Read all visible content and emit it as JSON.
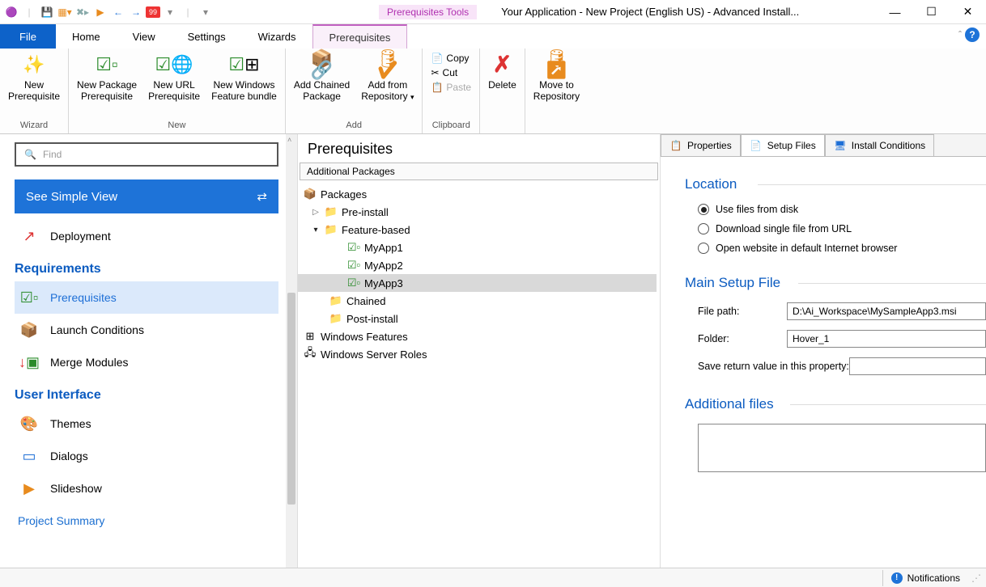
{
  "titlebar": {
    "tools_tab": "Prerequisites Tools",
    "title": "Your Application - New Project (English US) - Advanced Install...",
    "qat_badge": "99"
  },
  "tabs": {
    "file": "File",
    "home": "Home",
    "view": "View",
    "settings": "Settings",
    "wizards": "Wizards",
    "prerequisites": "Prerequisites"
  },
  "ribbon": {
    "wizard": {
      "new_prereq": "New\nPrerequisite",
      "group": "Wizard"
    },
    "new": {
      "new_package": "New Package\nPrerequisite",
      "new_url": "New URL\nPrerequisite",
      "new_bundle": "New Windows\nFeature bundle",
      "group": "New"
    },
    "add": {
      "add_chained": "Add Chained\nPackage",
      "add_repo": "Add from\nRepository",
      "group": "Add"
    },
    "clipboard": {
      "copy": "Copy",
      "cut": "Cut",
      "paste": "Paste",
      "group": "Clipboard"
    },
    "delete": "Delete",
    "move": "Move to\nRepository"
  },
  "sidebar": {
    "search_placeholder": "Find",
    "simple_view": "See Simple View",
    "deployment": "Deployment",
    "sections": {
      "requirements": "Requirements",
      "ui": "User Interface"
    },
    "items": {
      "prerequisites": "Prerequisites",
      "launch_conditions": "Launch Conditions",
      "merge_modules": "Merge Modules",
      "themes": "Themes",
      "dialogs": "Dialogs",
      "slideshow": "Slideshow"
    },
    "project_summary": "Project Summary"
  },
  "center": {
    "header": "Prerequisites",
    "additional_packages": "Additional Packages",
    "tree": {
      "packages": "Packages",
      "pre_install": "Pre-install",
      "feature_based": "Feature-based",
      "myapp1": "MyApp1",
      "myapp2": "MyApp2",
      "myapp3": "MyApp3",
      "chained": "Chained",
      "post_install": "Post-install",
      "windows_features": "Windows Features",
      "windows_server_roles": "Windows Server Roles"
    }
  },
  "right": {
    "tabs": {
      "properties": "Properties",
      "setup_files": "Setup Files",
      "install_conditions": "Install Conditions"
    },
    "location": {
      "title": "Location",
      "use_files": "Use files from disk",
      "download": "Download single file from URL",
      "open_website": "Open website in default Internet browser"
    },
    "main_setup": {
      "title": "Main Setup File",
      "file_path_label": "File path:",
      "file_path_value": "D:\\Ai_Workspace\\MySampleApp3.msi",
      "folder_label": "Folder:",
      "folder_value": "Hover_1",
      "save_return_label": "Save return value in this property:"
    },
    "additional_files": {
      "title": "Additional files"
    }
  },
  "statusbar": {
    "notifications": "Notifications"
  }
}
